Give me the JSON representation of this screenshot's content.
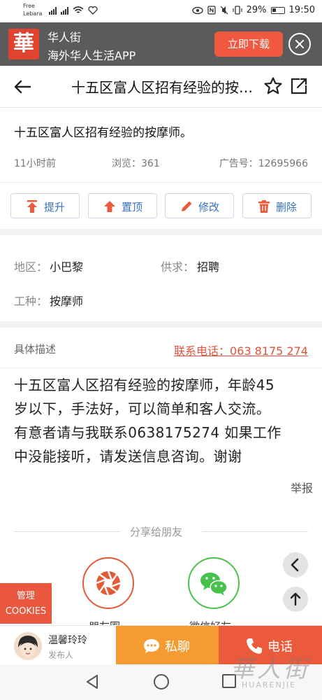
{
  "status_bar": {
    "carrier_line1": "Free",
    "carrier_line2": "Lebara",
    "battery": "29%",
    "time": "19:50"
  },
  "banner": {
    "logo_char": "華",
    "app_name": "华人街",
    "tagline": "海外华人生活APP",
    "download_label": "立即下载"
  },
  "header": {
    "title": "十五区富人区招有经验的按摩师。"
  },
  "post": {
    "title": "十五区富人区招有经验的按摩师。",
    "time": "11小时前",
    "views": "浏览：361",
    "ad_number": "广告号：12695966"
  },
  "actions": [
    {
      "label": "提升",
      "icon": "boost-icon"
    },
    {
      "label": "置顶",
      "icon": "pin-top-icon"
    },
    {
      "label": "修改",
      "icon": "edit-icon"
    },
    {
      "label": "删除",
      "icon": "trash-icon"
    }
  ],
  "info": {
    "region_label": "地区：",
    "region_value": "小巴黎",
    "supply_label": "供求：",
    "supply_value": "招聘",
    "job_label": "工种：",
    "job_value": "按摩师"
  },
  "description": {
    "title": "具体描述",
    "contact": "联系电话：063 8175 274",
    "line1": "十五区富人区招有经验的按摩师，年龄45",
    "line2": "岁以下，手法好，可以简单和客人交流。",
    "line3": "有意者请与我联系0638175274 如果工作",
    "line4": "中没能接听，请发送信息咨询。谢谢",
    "report": "举报"
  },
  "share": {
    "title": "分享给朋友",
    "moments_label": "朋友圈",
    "wechat_label": "微信好友"
  },
  "cookies": {
    "line1": "管理",
    "line2": "COOKIES"
  },
  "bottom": {
    "user_name": "温馨玲玲",
    "user_role": "发布人",
    "chat_label": "私聊",
    "call_label": "电话"
  },
  "watermark": {
    "cn": "華人街",
    "en": "HUARENJIE"
  },
  "colors": {
    "accent": "#ec5a3c",
    "chat": "#f49b32",
    "link": "#3a72c4",
    "banner_bg": "#5b5b5b"
  }
}
